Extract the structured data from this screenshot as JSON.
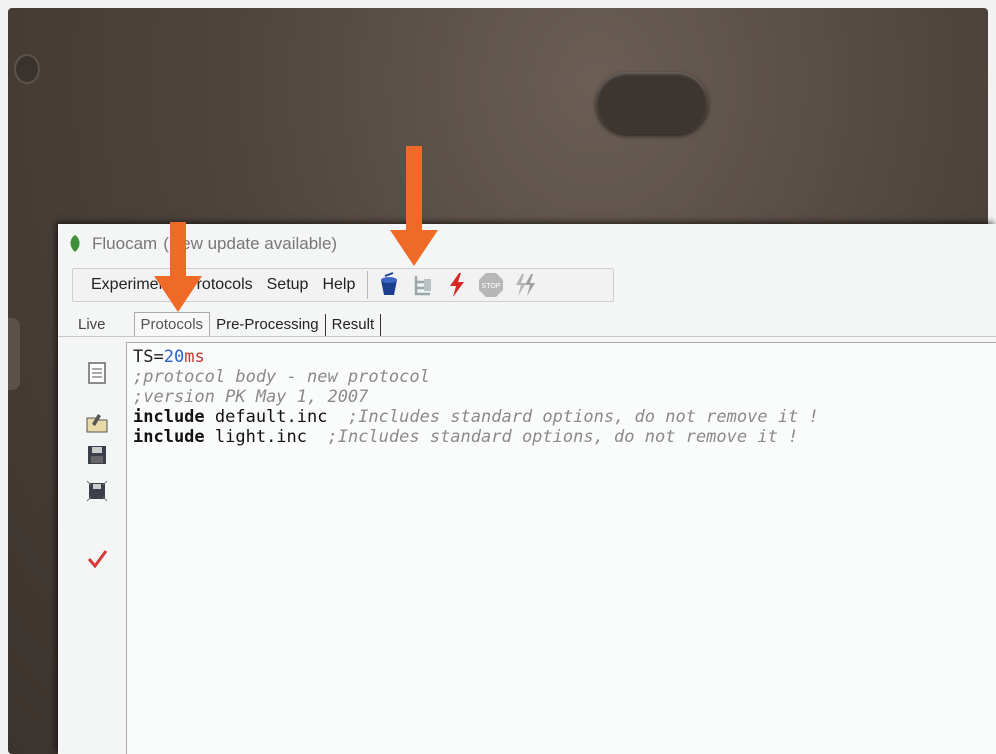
{
  "window": {
    "title": "Fluocam",
    "title_status": "(New update available)",
    "title_hidden": "Fluocam"
  },
  "menu": {
    "items": [
      "Experiment",
      "Protocols",
      "Setup",
      "Help"
    ]
  },
  "toolbar": {
    "icons": [
      "bucket-icon",
      "tree-icon",
      "flash-icon",
      "stop-icon",
      "multi-flash-icon"
    ],
    "stop_label": "STOP"
  },
  "tabs": {
    "items": [
      "Live",
      "Protocols",
      "Pre-Processing",
      "Result"
    ],
    "active": "Protocols"
  },
  "editor": {
    "line1": {
      "key": "TS=",
      "value": "20",
      "unit": "ms"
    },
    "line2": ";protocol body - new protocol",
    "line3": ";version PK May 1, 2007",
    "line4": {
      "keyword": "include",
      "file": " default.inc",
      "comment": "  ;Includes standard options, do not remove it !"
    },
    "line5": {
      "keyword": "include",
      "file": " light.inc",
      "comment": "  ;Includes standard options, do not remove it !"
    }
  },
  "colors": {
    "arrow": "#ef6a27",
    "ts_value": "#2a5fd0",
    "ts_unit": "#c0392b",
    "comment": "#8a8a8a",
    "check": "#d33a3a"
  }
}
